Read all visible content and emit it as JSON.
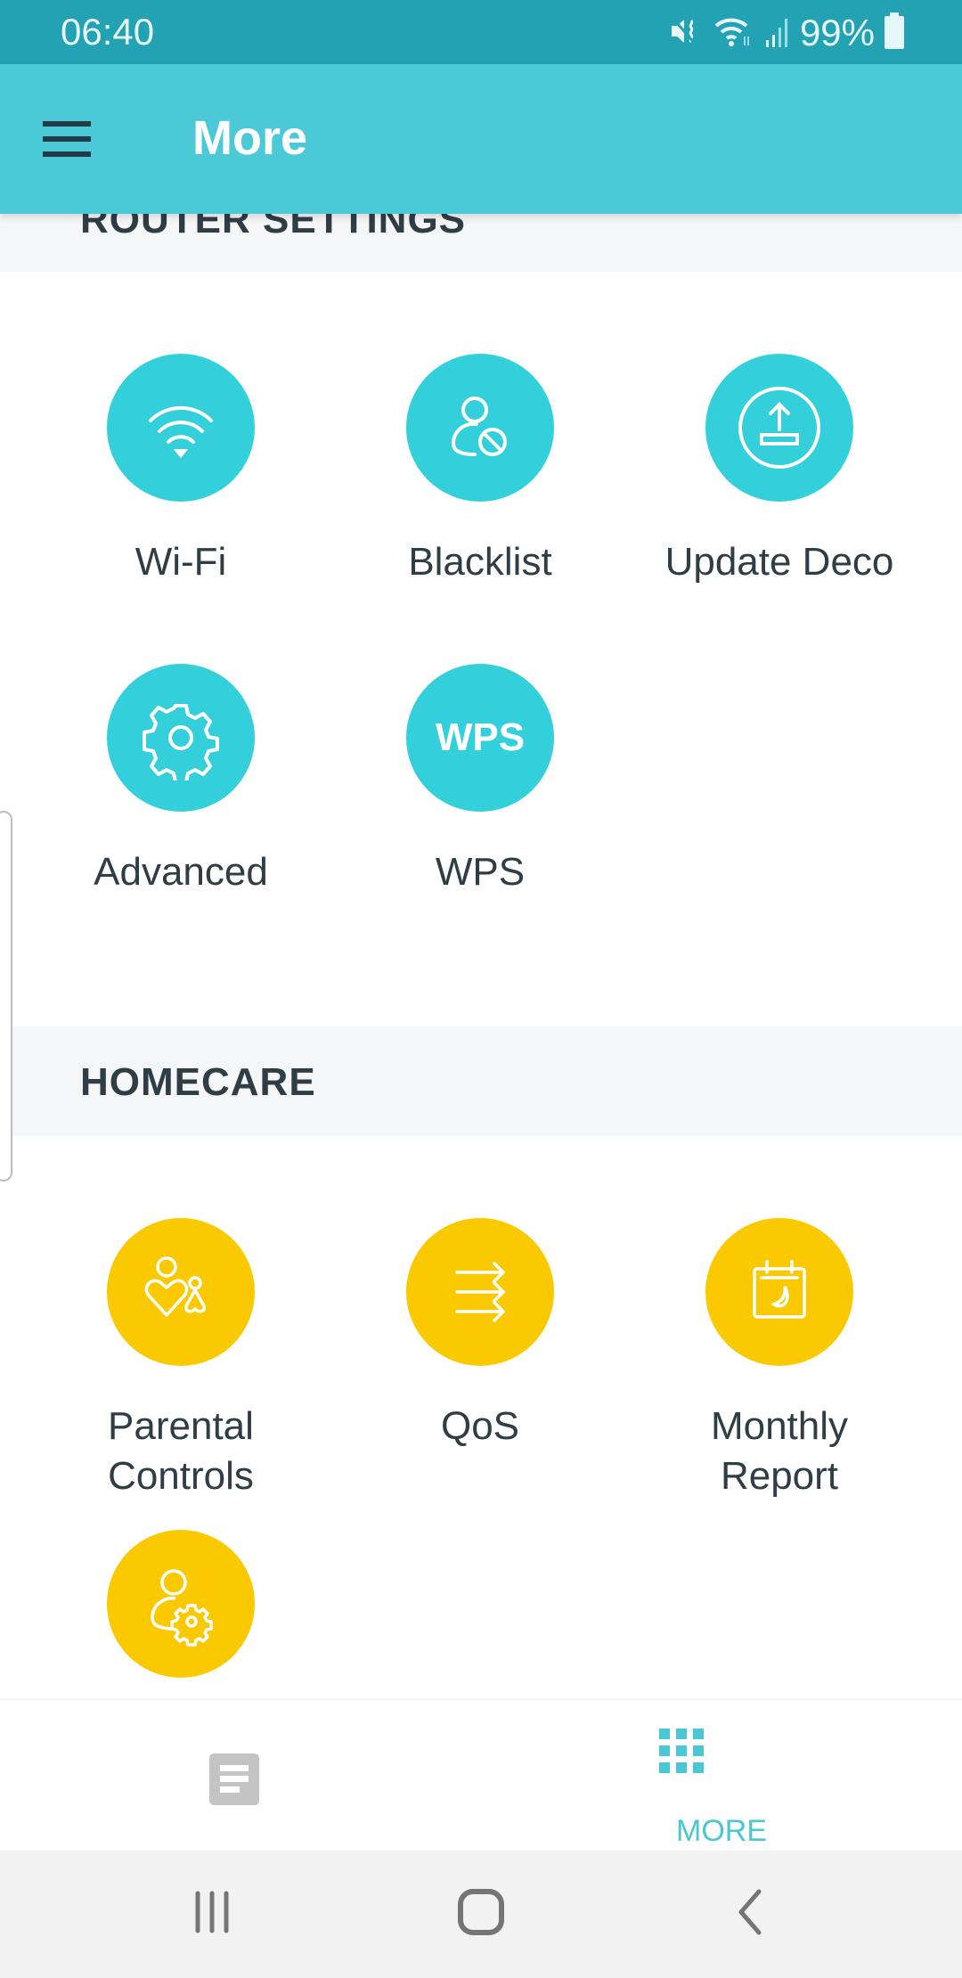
{
  "status_bar": {
    "time": "06:40",
    "battery_percent": "99%",
    "icons": [
      "mute-vibrate-icon",
      "wifi-data-icon",
      "cell-signal-icon",
      "battery-icon"
    ]
  },
  "app_bar": {
    "title": "More",
    "menu_icon": "hamburger-menu-icon"
  },
  "sections": [
    {
      "title": "ROUTER SETTINGS",
      "color": "#33d0db",
      "items": [
        {
          "label": "Wi-Fi",
          "icon": "wifi-icon"
        },
        {
          "label": "Blacklist",
          "icon": "user-blocked-icon"
        },
        {
          "label": "Update Deco",
          "icon": "upload-icon"
        },
        {
          "label": "Advanced",
          "icon": "gear-icon"
        },
        {
          "label": "WPS",
          "icon": "wps-icon",
          "icon_text": "WPS"
        }
      ]
    },
    {
      "title": "HOMECARE",
      "color": "#fbc900",
      "items": [
        {
          "label_line1": "Parental",
          "label_line2": "Controls",
          "icon": "parental-controls-icon"
        },
        {
          "label": "QoS",
          "icon": "qos-arrows-icon"
        },
        {
          "label_line1": "Monthly",
          "label_line2": "Report",
          "icon": "calendar-moon-icon"
        },
        {
          "label": "",
          "icon": "user-settings-icon"
        }
      ]
    }
  ],
  "bottom_nav": {
    "items": [
      {
        "label": "",
        "icon": "overview-list-icon",
        "active": false
      },
      {
        "label": "MORE",
        "icon": "grid-icon",
        "active": true
      }
    ],
    "active_color": "#4bc6d3",
    "inactive_color": "#c4c4c4"
  },
  "system_nav": {
    "buttons": [
      "recent-apps",
      "home",
      "back"
    ]
  }
}
